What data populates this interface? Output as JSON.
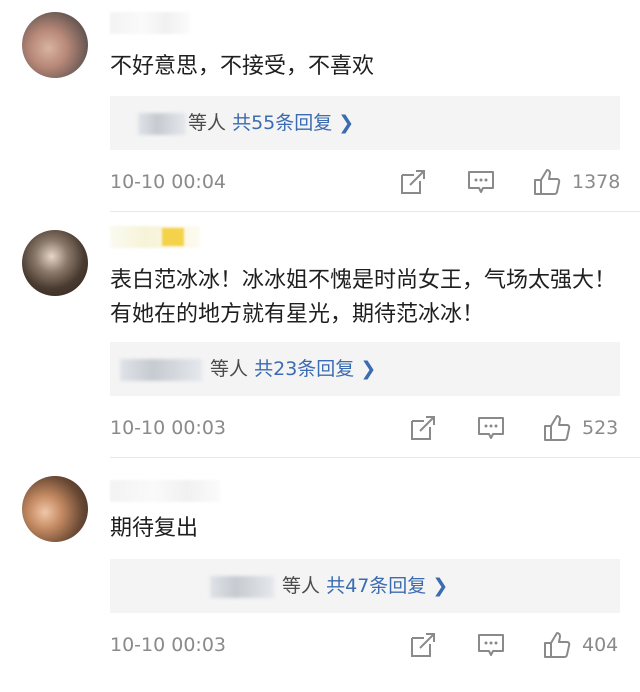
{
  "comments": [
    {
      "text": "不好意思，不接受，不喜欢",
      "reply_suffix": "等人",
      "reply_count": "共55条回复",
      "time": "10-10 00:04",
      "likes": "1378"
    },
    {
      "text": "表白范冰冰！冰冰姐不愧是时尚女王，气场太强大！有她在的地方就有星光，期待范冰冰！",
      "reply_suffix": "等人",
      "reply_count": "共23条回复",
      "time": "10-10 00:03",
      "likes": "523"
    },
    {
      "text": "期待复出",
      "reply_suffix": "等人",
      "reply_count": "共47条回复",
      "time": "10-10 00:03",
      "likes": "404"
    }
  ],
  "icons": {
    "repost": "share-icon",
    "comment": "comment-icon",
    "like": "thumbs-up-icon",
    "chevron": "chevron-right-icon"
  },
  "colors": {
    "link": "#3b6bb0",
    "meta": "#8a8a8a",
    "reply_bg": "#f4f4f4"
  }
}
